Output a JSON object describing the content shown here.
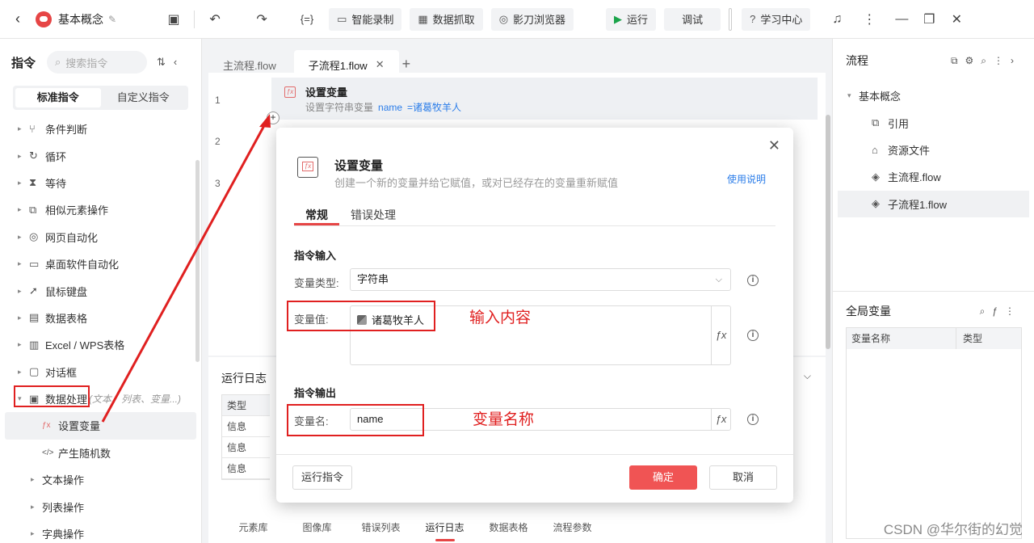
{
  "topbar": {
    "project_name": "基本概念",
    "buttons": {
      "smart_record": "智能录制",
      "data_capture": "数据抓取",
      "browser": "影刀浏览器",
      "run": "运行",
      "debug": "调试",
      "learning": "学习中心"
    },
    "code_icon_text": "{=}"
  },
  "left": {
    "title": "指令",
    "search_placeholder": "搜索指令",
    "seg_standard": "标准指令",
    "seg_custom": "自定义指令",
    "items": [
      {
        "label": "条件判断",
        "icon": "branch-icon"
      },
      {
        "label": "循环",
        "icon": "loop-icon"
      },
      {
        "label": "等待",
        "icon": "hourglass-icon"
      },
      {
        "label": "相似元素操作",
        "icon": "similar-icon"
      },
      {
        "label": "网页自动化",
        "icon": "browser-icon"
      },
      {
        "label": "桌面软件自动化",
        "icon": "monitor-icon"
      },
      {
        "label": "鼠标键盘",
        "icon": "cursor-icon"
      },
      {
        "label": "数据表格",
        "icon": "table-icon"
      },
      {
        "label": "Excel / WPS表格",
        "icon": "excel-icon"
      },
      {
        "label": "对话框",
        "icon": "dialog-icon"
      },
      {
        "label": "数据处理",
        "icon": "data-icon",
        "hint": "(文本、列表、变量...)"
      }
    ],
    "children": [
      {
        "label": "设置变量",
        "icon": "fx-icon"
      },
      {
        "label": "产生随机数",
        "icon": "random-icon"
      }
    ],
    "sub_groups": [
      "文本操作",
      "列表操作",
      "字典操作"
    ]
  },
  "editor": {
    "tabs": [
      {
        "label": "主流程.flow"
      },
      {
        "label": "子流程1.flow"
      }
    ],
    "line_numbers": [
      "1",
      "2",
      "3"
    ],
    "step": {
      "title": "设置变量",
      "desc_prefix": "设置字符串变量",
      "var_name": "name",
      "var_value": "=诸葛牧羊人"
    }
  },
  "log": {
    "title": "运行日志",
    "header": "类型",
    "rows": [
      "信息",
      "信息",
      "信息"
    ],
    "bottom_tabs": [
      "元素库",
      "图像库",
      "错误列表",
      "运行日志",
      "数据表格",
      "流程参数"
    ]
  },
  "right": {
    "title": "流程",
    "root": "基本概念",
    "items": [
      {
        "label": "引用",
        "icon": "reference-icon"
      },
      {
        "label": "资源文件",
        "icon": "resource-icon"
      },
      {
        "label": "主流程.flow",
        "icon": "layers-icon"
      },
      {
        "label": "子流程1.flow",
        "icon": "layers-icon"
      }
    ],
    "global_vars_title": "全局变量",
    "col_name": "变量名称",
    "col_type": "类型",
    "watermark": "CSDN @华尔街的幻觉"
  },
  "modal": {
    "title": "设置变量",
    "subtitle": "创建一个新的变量并给它赋值，或对已经存在的变量重新赋值",
    "help": "使用说明",
    "tab_general": "常规",
    "tab_error": "错误处理",
    "section_input": "指令输入",
    "label_type": "变量类型:",
    "type_value": "字符串",
    "label_value": "变量值:",
    "value": "诸葛牧羊人",
    "section_output": "指令输出",
    "label_name": "变量名:",
    "name_value": "name",
    "annotation_input": "输入内容",
    "annotation_name": "变量名称",
    "btn_run": "运行指令",
    "btn_ok": "确定",
    "btn_cancel": "取消"
  },
  "colors": {
    "accent_red": "#e64545",
    "confirm": "#f05454",
    "link_blue": "#2b7de9",
    "annotation": "#e02020"
  }
}
